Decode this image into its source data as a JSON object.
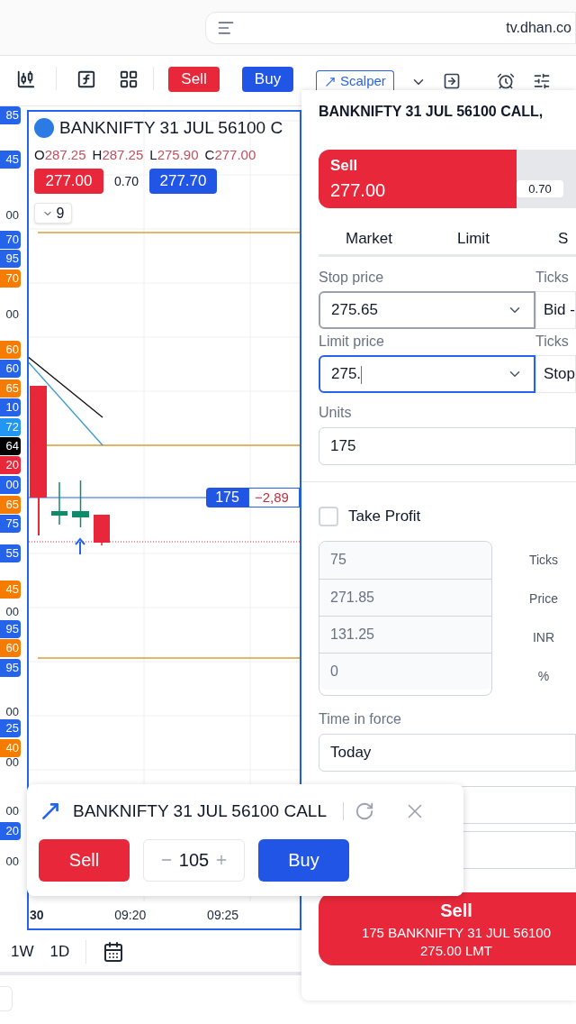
{
  "browser": {
    "url": "tv.dhan.co"
  },
  "toolbar": {
    "sell": "Sell",
    "buy": "Buy",
    "scalper": "Scalper"
  },
  "price_axis": {
    "labels": [
      {
        "text": "85",
        "color": "#2563eb"
      },
      {
        "text": "45",
        "color": "#2563eb"
      },
      {
        "text": "00"
      },
      {
        "text": "70",
        "color": "#2563eb"
      },
      {
        "text": "95",
        "color": "#2563eb"
      },
      {
        "text": "70",
        "color": "#f57c00"
      },
      {
        "text": "00"
      },
      {
        "text": "60",
        "color": "#f57c00"
      },
      {
        "text": "60",
        "color": "#2563eb"
      },
      {
        "text": "65",
        "color": "#f57c00"
      },
      {
        "text": "10",
        "color": "#2563eb"
      },
      {
        "text": "72",
        "color": "#2196f3"
      },
      {
        "text": "64",
        "color": "#000000"
      },
      {
        "text": "20",
        "color": "#e8273a"
      },
      {
        "text": "00",
        "color": "#2563eb"
      },
      {
        "text": "65",
        "color": "#f57c00"
      },
      {
        "text": "75",
        "color": "#2563eb"
      },
      {
        "text": "55",
        "color": "#2563eb"
      },
      {
        "text": "45",
        "color": "#f57c00"
      },
      {
        "text": "00"
      },
      {
        "text": "95",
        "color": "#2563eb"
      },
      {
        "text": "60",
        "color": "#f57c00"
      },
      {
        "text": "95",
        "color": "#2563eb"
      },
      {
        "text": "00"
      },
      {
        "text": "25",
        "color": "#2563eb"
      },
      {
        "text": "40",
        "color": "#f57c00"
      },
      {
        "text": "00"
      },
      {
        "text": "00"
      },
      {
        "text": "20",
        "color": "#2563eb"
      },
      {
        "text": "00"
      }
    ]
  },
  "chart": {
    "symbol": "BANKNIFTY 31 JUL 56100 C",
    "ohlc": [
      {
        "label": "O",
        "value": "287.25"
      },
      {
        "label": "H",
        "value": "287.25"
      },
      {
        "label": "L",
        "value": "275.90"
      },
      {
        "label": "C",
        "value": "277.00"
      }
    ],
    "bid": "277.00",
    "spread": "0.70",
    "ask": "277.70",
    "indicators": "9",
    "position": {
      "quantity": "175",
      "pnl": "−2,89"
    },
    "time_axis": [
      "30",
      "09:20",
      "09:25"
    ]
  },
  "intervals": [
    "1W",
    "1D"
  ],
  "order_panel": {
    "title": "BANKNIFTY 31 JUL 56100 CALL,",
    "side": {
      "label": "Sell",
      "price": "277.00",
      "spread": "0.70"
    },
    "tabs": [
      "Market",
      "Limit",
      "S"
    ],
    "stop_price": {
      "label": "Stop price",
      "value": "275.65",
      "focused": false,
      "ticks_label": "Ticks",
      "ticks_value": "Bid -"
    },
    "limit_price": {
      "label": "Limit price",
      "value": "275.",
      "focused": true,
      "ticks_label": "Ticks",
      "ticks_value": "Stop"
    },
    "units": {
      "label": "Units",
      "value": "175"
    },
    "take_profit": {
      "label": "Take Profit",
      "checked": false,
      "fields": [
        {
          "placeholder": "75",
          "label": "Ticks"
        },
        {
          "placeholder": "271.85",
          "label": "Price"
        },
        {
          "placeholder": "131.25",
          "label": "INR"
        },
        {
          "placeholder": "0",
          "label": "%"
        }
      ]
    },
    "time_in_force": {
      "label": "Time in force",
      "value": "Today"
    },
    "submit": {
      "title": "Sell",
      "lines": [
        "175 BANKNIFTY 31 JUL 56100",
        "275.00 LMT"
      ]
    }
  },
  "quick_trade": {
    "title": "BANKNIFTY 31 JUL 56100 CALL",
    "sell": "Sell",
    "quantity": "105",
    "buy": "Buy"
  }
}
